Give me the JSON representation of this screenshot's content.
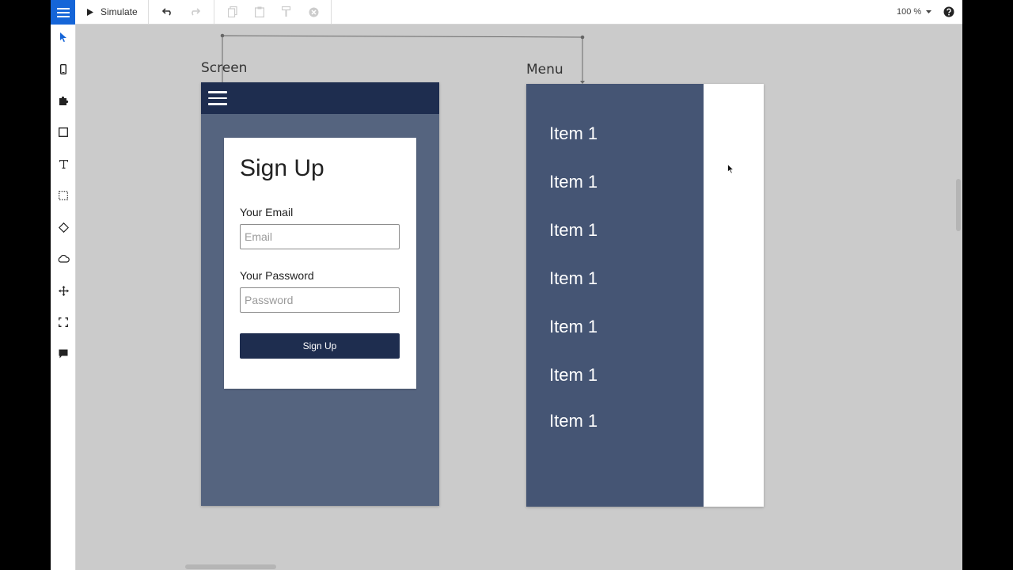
{
  "toolbar": {
    "simulate_label": "Simulate",
    "zoom_value": "100 %"
  },
  "toolbox": {
    "tools": [
      "pointer-icon",
      "mobile-device-icon",
      "puzzle-icon",
      "rectangle-icon",
      "text-icon",
      "dashed-rect-icon",
      "diamond-icon",
      "cloud-icon",
      "move-icon",
      "selection-icon",
      "comment-icon"
    ]
  },
  "canvas": {
    "screen_label": "Screen",
    "menu_label": "Menu",
    "signup_card": {
      "title": "Sign Up",
      "email_label": "Your Email",
      "email_placeholder": "Email",
      "password_label": "Your Password",
      "password_placeholder": "Password",
      "button_label": "Sign Up"
    },
    "menu_items": [
      "Item 1",
      "Item 1",
      "Item 1",
      "Item 1",
      "Item 1",
      "Item 1",
      "Item 1"
    ]
  },
  "colors": {
    "accent": "#1565d8",
    "header_navy": "#1e2d4f",
    "screen_bg": "#55647f",
    "menu_bg": "#455574",
    "canvas_bg": "#cbcbcb"
  }
}
